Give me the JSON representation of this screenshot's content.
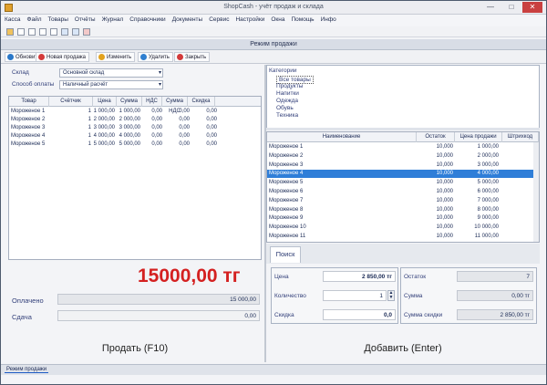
{
  "window": {
    "title": "ShopCash - учёт продаж и склада",
    "min": "—",
    "max": "□",
    "close": "✕"
  },
  "menu": [
    "Касса",
    "Файл",
    "Товары",
    "Отчёты",
    "Журнал",
    "Справочники",
    "Документы",
    "Сервис",
    "Настройки",
    "Окна",
    "Помощь",
    "Инфо"
  ],
  "sub_window": {
    "title": "Режим продажи"
  },
  "sub_tools": [
    {
      "label": "Обновить",
      "color": "#2a78c9"
    },
    {
      "label": "Новая продажа",
      "color": "#d43a3a"
    },
    {
      "label": "Изменить",
      "color": "#e2a21d"
    },
    {
      "label": "Удалить",
      "color": "#2f7fd0"
    },
    {
      "label": "Закрыть",
      "color": "#d33a3a"
    }
  ],
  "left": {
    "client_label": "Склад",
    "client_value": "Основной склад",
    "payment_label": "Способ оплаты",
    "payment_value": "Наличный расчёт",
    "columns": [
      "Товар",
      "Счётчик",
      "Цена",
      "Сумма",
      "НДС",
      "Сумма НДС",
      "Скидка"
    ],
    "rows": [
      [
        "Мороженое 1",
        "1",
        "1 000,00",
        "1 000,00",
        "0,00",
        "0,00",
        "0,00"
      ],
      [
        "Мороженое 2",
        "1",
        "2 000,00",
        "2 000,00",
        "0,00",
        "0,00",
        "0,00"
      ],
      [
        "Мороженое 3",
        "1",
        "3 000,00",
        "3 000,00",
        "0,00",
        "0,00",
        "0,00"
      ],
      [
        "Мороженое 4",
        "1",
        "4 000,00",
        "4 000,00",
        "0,00",
        "0,00",
        "0,00"
      ],
      [
        "Мороженое 5",
        "1",
        "5 000,00",
        "5 000,00",
        "0,00",
        "0,00",
        "0,00"
      ]
    ],
    "total": "15000,00 тг",
    "paid_label": "Оплачено",
    "paid_value": "15 000,00",
    "change_label": "Сдача",
    "change_value": "0,00",
    "sell_button": "Продать (F10)"
  },
  "right": {
    "tree_title": "Категории",
    "tree_items": [
      "Все товары",
      "Продукты",
      "Напитки",
      "Одежда",
      "Обувь",
      "Техника"
    ],
    "columns": [
      "Наименование",
      "Остаток",
      "Цена продажи",
      "Штрихкод"
    ],
    "rows": [
      [
        "Мороженое 1",
        "10,000",
        "1 000,00"
      ],
      [
        "Мороженое 2",
        "10,000",
        "2 000,00"
      ],
      [
        "Мороженое 3",
        "10,000",
        "3 000,00"
      ],
      [
        "Мороженое 4",
        "10,000",
        "4 000,00"
      ],
      [
        "Мороженое 5",
        "10,000",
        "5 000,00"
      ],
      [
        "Мороженое 6",
        "10,000",
        "6 000,00"
      ],
      [
        "Мороженое 7",
        "10,000",
        "7 000,00"
      ],
      [
        "Мороженое 8",
        "10,000",
        "8 000,00"
      ],
      [
        "Мороженое 9",
        "10,000",
        "9 000,00"
      ],
      [
        "Мороженое 10",
        "10,000",
        "10 000,00"
      ],
      [
        "Мороженое 11",
        "10,000",
        "11 000,00"
      ]
    ],
    "selected_row": 3,
    "search_tab": "Поиск",
    "price_label": "Цена",
    "price_value": "2 850,00 тг",
    "qty_label": "Количество",
    "qty_value": "1",
    "discount_label": "Скидка",
    "discount_value": "0,0",
    "stock_label": "Остаток",
    "stock_value": "7",
    "sum_label": "Сумма",
    "sum_value": "0,00 тг",
    "sum_disc_label": "Сумма скидки",
    "sum_disc_value": "2 850,00 тг",
    "add_button": "Добавить (Enter)"
  },
  "status": {
    "tab": "Режим продажи"
  }
}
